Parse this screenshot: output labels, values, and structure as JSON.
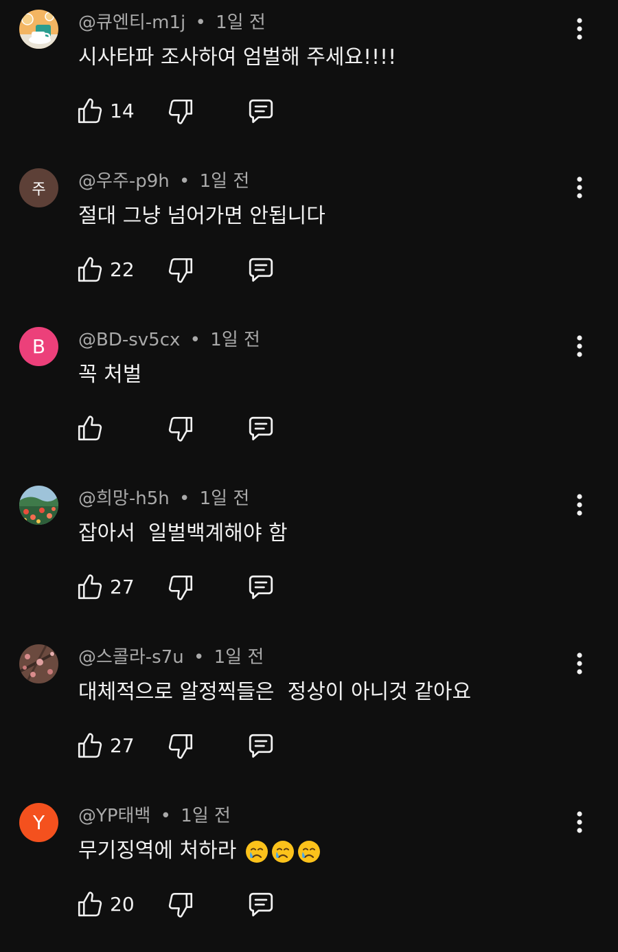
{
  "colors": {
    "background": "#0f0f0f",
    "text_primary": "#f1f1f1",
    "text_secondary": "#aaaaaa",
    "avatar_ju": "#5d4037",
    "avatar_b": "#ec407a",
    "avatar_y": "#f4511e"
  },
  "comments": [
    {
      "author": "@큐엔티-m1j",
      "separator": "•",
      "time": "1일 전",
      "text": "시사타파 조사하여 엄벌해 주세요!!!!",
      "likes": "14",
      "avatar": {
        "type": "image",
        "icon": "coffee-cup-picture"
      }
    },
    {
      "author": "@우주-p9h",
      "separator": "•",
      "time": "1일 전",
      "text": "절대 그냥 넘어가면 안됩니다",
      "likes": "22",
      "avatar": {
        "type": "initial",
        "initial": "주"
      }
    },
    {
      "author": "@BD-sv5cx",
      "separator": "•",
      "time": "1일 전",
      "text": "꼭 처벌",
      "likes": "",
      "avatar": {
        "type": "initial",
        "initial": "B"
      }
    },
    {
      "author": "@희망-h5h",
      "separator": "•",
      "time": "1일 전",
      "text": "잡아서  일벌백계해야 함",
      "likes": "27",
      "avatar": {
        "type": "image",
        "icon": "flower-field-picture"
      }
    },
    {
      "author": "@스콜라-s7u",
      "separator": "•",
      "time": "1일 전",
      "text": "대체적으로 알정찍들은  정상이 아니것 같아요",
      "likes": "27",
      "avatar": {
        "type": "image",
        "icon": "blossom-branch-picture"
      }
    },
    {
      "author": "@YP태백",
      "separator": "•",
      "time": "1일 전",
      "text": "무기징역에 처하라",
      "likes": "20",
      "avatar": {
        "type": "initial",
        "initial": "Y"
      },
      "emojis": [
        "crying-face-emoji",
        "crying-face-emoji",
        "crying-face-emoji"
      ]
    }
  ]
}
